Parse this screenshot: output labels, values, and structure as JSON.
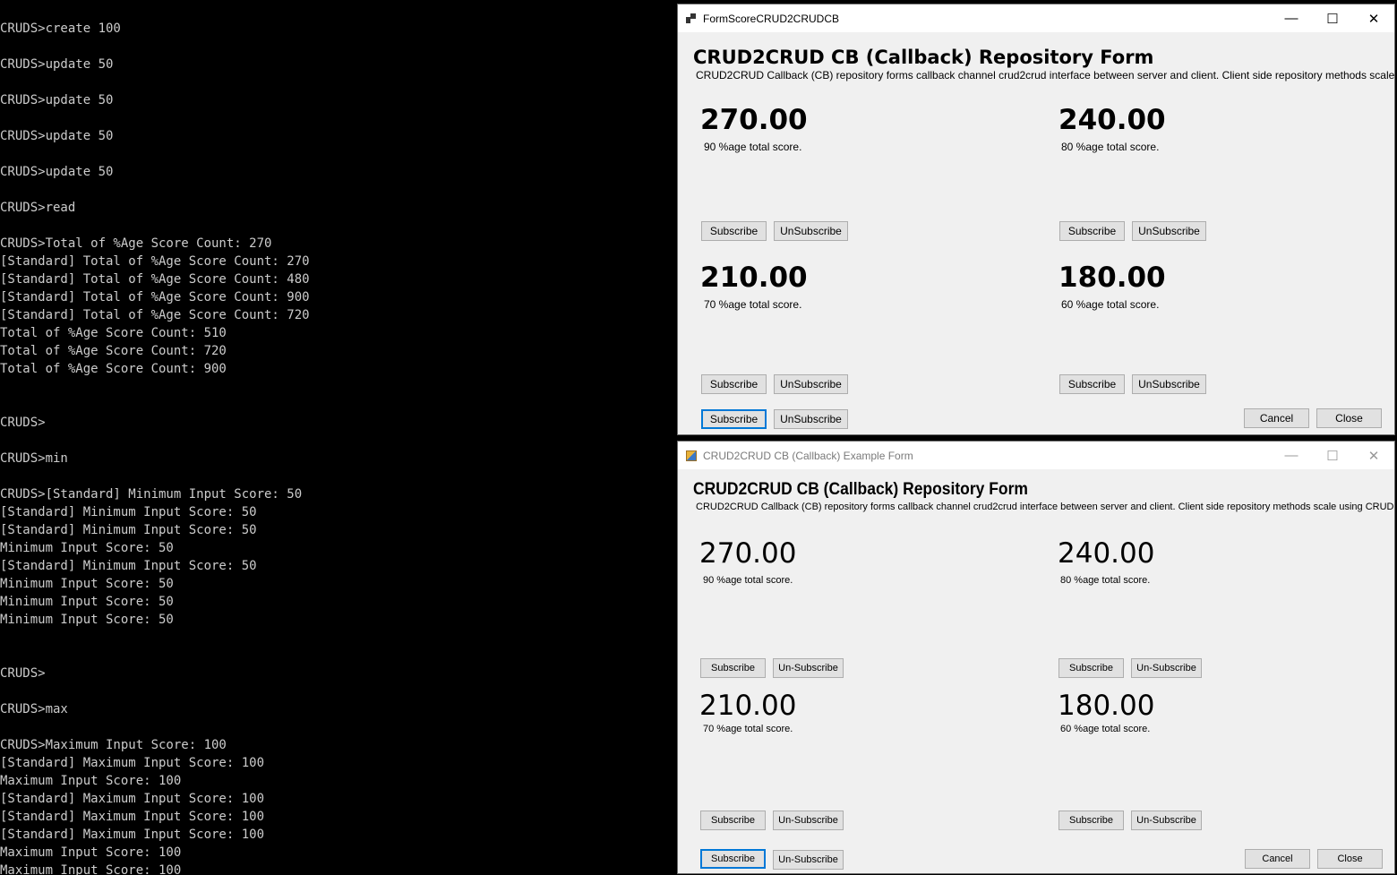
{
  "console": {
    "lines": [
      "CRUDS>create 100",
      "",
      "CRUDS>update 50",
      "",
      "CRUDS>update 50",
      "",
      "CRUDS>update 50",
      "",
      "CRUDS>update 50",
      "",
      "CRUDS>read",
      "",
      "CRUDS>Total of %Age Score Count: 270",
      "[Standard] Total of %Age Score Count: 270",
      "[Standard] Total of %Age Score Count: 480",
      "[Standard] Total of %Age Score Count: 900",
      "[Standard] Total of %Age Score Count: 720",
      "Total of %Age Score Count: 510",
      "Total of %Age Score Count: 720",
      "Total of %Age Score Count: 900",
      "",
      "",
      "CRUDS>",
      "",
      "CRUDS>min",
      "",
      "CRUDS>[Standard] Minimum Input Score: 50",
      "[Standard] Minimum Input Score: 50",
      "[Standard] Minimum Input Score: 50",
      "Minimum Input Score: 50",
      "[Standard] Minimum Input Score: 50",
      "Minimum Input Score: 50",
      "Minimum Input Score: 50",
      "Minimum Input Score: 50",
      "",
      "",
      "CRUDS>",
      "",
      "CRUDS>max",
      "",
      "CRUDS>Maximum Input Score: 100",
      "[Standard] Maximum Input Score: 100",
      "Maximum Input Score: 100",
      "[Standard] Maximum Input Score: 100",
      "[Standard] Maximum Input Score: 100",
      "[Standard] Maximum Input Score: 100",
      "Maximum Input Score: 100",
      "Maximum Input Score: 100"
    ]
  },
  "form_top": {
    "title": "FormScoreCRUD2CRUDCB",
    "heading": "CRUD2CRUD CB (Callback) Repository Form",
    "description": "CRUD2CRUD Callback (CB) repository forms callback channel  crud2crud interface between server and client. Client side repository methods scale using CRUDM.",
    "panels": [
      {
        "score": "270.00",
        "label": "90 %age total score.",
        "subscribe": "Subscribe",
        "unsubscribe": "UnSubscribe"
      },
      {
        "score": "240.00",
        "label": "80 %age total score.",
        "subscribe": "Subscribe",
        "unsubscribe": "UnSubscribe"
      },
      {
        "score": "210.00",
        "label": "70 %age total score.",
        "subscribe": "Subscribe",
        "unsubscribe": "UnSubscribe"
      },
      {
        "score": "180.00",
        "label": "60 %age total score.",
        "subscribe": "Subscribe",
        "unsubscribe": "UnSubscribe"
      }
    ],
    "footer": {
      "subscribe": "Subscribe",
      "unsubscribe": "UnSubscribe",
      "cancel": "Cancel",
      "close": "Close"
    }
  },
  "form_bottom": {
    "title": "CRUD2CRUD CB (Callback) Example Form",
    "heading": "CRUD2CRUD CB (Callback) Repository Form",
    "description": "CRUD2CRUD Callback (CB) repository forms callback channel  crud2crud interface between server and client. Client side repository methods scale using CRUDM.",
    "panels": [
      {
        "score": "270.00",
        "label": "90 %age total score.",
        "subscribe": "Subscribe",
        "unsubscribe": "Un-Subscribe"
      },
      {
        "score": "240.00",
        "label": "80 %age total score.",
        "subscribe": "Subscribe",
        "unsubscribe": "Un-Subscribe"
      },
      {
        "score": "210.00",
        "label": "70 %age total score.",
        "subscribe": "Subscribe",
        "unsubscribe": "Un-Subscribe"
      },
      {
        "score": "180.00",
        "label": "60 %age total score.",
        "subscribe": "Subscribe",
        "unsubscribe": "Un-Subscribe"
      }
    ],
    "footer": {
      "subscribe": "Subscribe",
      "unsubscribe": "Un-Subscribe",
      "cancel": "Cancel",
      "close": "Close"
    }
  },
  "window_controls": {
    "minimize": "—",
    "maximize": "☐",
    "close": "✕"
  }
}
